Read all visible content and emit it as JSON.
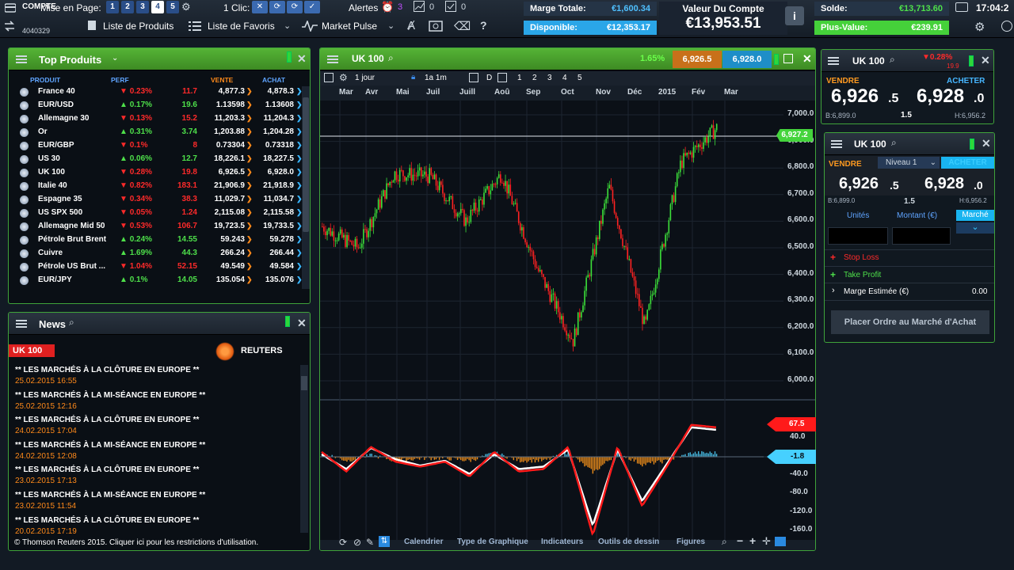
{
  "account": {
    "label": "COMPTE",
    "number": "4040329"
  },
  "pagination": {
    "label": "Mise en Page:",
    "pages": [
      "1",
      "2",
      "3",
      "4",
      "5"
    ]
  },
  "one_click": {
    "label": "1 Clic:"
  },
  "alerts": {
    "label": "Alertes",
    "count_alerts": "3",
    "count_b": "0",
    "count_c": "0"
  },
  "nav": {
    "products": "Liste de Produits",
    "favorites": "Liste de Favoris",
    "pulse": "Market Pulse"
  },
  "stats": {
    "margin_label": "Marge Totale:",
    "margin_value": "€1,600.34",
    "available_label": "Disponible:",
    "available_value": "€12,353.17",
    "account_value_label": "Valeur Du Compte",
    "account_value": "€13,953.51",
    "balance_label": "Solde:",
    "balance_value": "€13,713.60",
    "gain_label": "Plus-Value:",
    "gain_value": "€239.91"
  },
  "clock": "17:04:2",
  "top_products": {
    "title": "Top Produits",
    "headers": {
      "product": "PRODUIT",
      "perf": "PERF",
      "sell": "VENTE",
      "buy": "ACHAT"
    },
    "rows": [
      {
        "name": "France 40",
        "perf": "0.23%",
        "dir": "dn",
        "abs": "11.7",
        "sell": "4,877.3",
        "buy": "4,878.3"
      },
      {
        "name": "EUR/USD",
        "perf": "0.17%",
        "dir": "up",
        "abs": "19.6",
        "sell": "1.13598",
        "buy": "1.13608"
      },
      {
        "name": "Allemagne 30",
        "perf": "0.13%",
        "dir": "dn",
        "abs": "15.2",
        "sell": "11,203.3",
        "buy": "11,204.3"
      },
      {
        "name": "Or",
        "perf": "0.31%",
        "dir": "up",
        "abs": "3.74",
        "sell": "1,203.88",
        "buy": "1,204.28"
      },
      {
        "name": "EUR/GBP",
        "perf": "0.1%",
        "dir": "dn",
        "abs": "8",
        "sell": "0.73304",
        "buy": "0.73318"
      },
      {
        "name": "US 30",
        "perf": "0.06%",
        "dir": "up",
        "abs": "12.7",
        "sell": "18,226.1",
        "buy": "18,227.5"
      },
      {
        "name": "UK 100",
        "perf": "0.28%",
        "dir": "dn",
        "abs": "19.8",
        "sell": "6,926.5",
        "buy": "6,928.0"
      },
      {
        "name": "Italie 40",
        "perf": "0.82%",
        "dir": "dn",
        "abs": "183.1",
        "sell": "21,906.9",
        "buy": "21,918.9"
      },
      {
        "name": "Espagne 35",
        "perf": "0.34%",
        "dir": "dn",
        "abs": "38.3",
        "sell": "11,029.7",
        "buy": "11,034.7"
      },
      {
        "name": "US SPX 500",
        "perf": "0.05%",
        "dir": "dn",
        "abs": "1.24",
        "sell": "2,115.08",
        "buy": "2,115.58"
      },
      {
        "name": "Allemagne Mid 50",
        "perf": "0.53%",
        "dir": "dn",
        "abs": "106.7",
        "sell": "19,723.5",
        "buy": "19,733.5"
      },
      {
        "name": "Pétrole Brut Brent",
        "perf": "0.24%",
        "dir": "up",
        "abs": "14.55",
        "sell": "59.243",
        "buy": "59.278"
      },
      {
        "name": "Cuivre",
        "perf": "1.69%",
        "dir": "up",
        "abs": "44.3",
        "sell": "266.24",
        "buy": "266.44"
      },
      {
        "name": "Pétrole US Brut ...",
        "perf": "1.04%",
        "dir": "dn",
        "abs": "52.15",
        "sell": "49.549",
        "buy": "49.584"
      },
      {
        "name": "EUR/JPY",
        "perf": "0.1%",
        "dir": "up",
        "abs": "14.05",
        "sell": "135.054",
        "buy": "135.076"
      }
    ]
  },
  "news": {
    "title": "News",
    "tag": "UK 100",
    "source": "REUTERS",
    "items": [
      {
        "title": "** LES MARCHÉS À LA CLÔTURE EN EUROPE **",
        "date": "25.02.2015 16:55"
      },
      {
        "title": "** LES MARCHÉS À LA MI-SÉANCE EN EUROPE **",
        "date": "25.02.2015 12:16"
      },
      {
        "title": "** LES MARCHÉS À LA CLÔTURE EN EUROPE **",
        "date": "24.02.2015 17:04"
      },
      {
        "title": "** LES MARCHÉS À LA MI-SÉANCE EN EUROPE **",
        "date": "24.02.2015 12:08"
      },
      {
        "title": "** LES MARCHÉS À LA CLÔTURE EN EUROPE **",
        "date": "23.02.2015 17:13"
      },
      {
        "title": "** LES MARCHÉS À LA MI-SÉANCE EN EUROPE **",
        "date": "23.02.2015 11:54"
      },
      {
        "title": "** LES MARCHÉS À LA CLÔTURE EN EUROPE **",
        "date": "20.02.2015 17:19"
      }
    ],
    "footer": "© Thomson Reuters 2015. Cliquer ici pour les restrictions d'utilisation."
  },
  "chart": {
    "title": "UK 100",
    "change": "1.65%",
    "sell": "6,926.5",
    "buy": "6,928.0",
    "interval": "1 jour",
    "range": "1a 1m",
    "periods": [
      "D",
      "1",
      "2",
      "3",
      "4",
      "5"
    ],
    "last_tag": "6,927.2",
    "macd_tag1": "67.5",
    "macd_tag2": "-1.8",
    "bottom_tabs": [
      "Calendrier",
      "Type de Graphique",
      "Indicateurs",
      "Outils de dessin",
      "Figures"
    ]
  },
  "chart_data": {
    "type": "candlestick",
    "x_labels": [
      "Mar",
      "Avr",
      "Mai",
      "Juil",
      "Juill",
      "Aoû",
      "Sep",
      "Oct",
      "Nov",
      "Déc",
      "2015",
      "Fév",
      "Mar"
    ],
    "y_ticks": [
      "7,000.0",
      "6,900.0",
      "6,800.0",
      "6,700.0",
      "6,600.0",
      "6,500.0",
      "6,400.0",
      "6,300.0",
      "6,200.0",
      "6,100.0",
      "6,000.0"
    ],
    "ylim": [
      6000,
      7000
    ],
    "macd_ticks": [
      "40.0",
      "-40.0",
      "-80.0",
      "-120.0",
      "-160.0"
    ],
    "trend_y": [
      6580,
      6500,
      6780,
      6770,
      6600,
      6780,
      6420,
      6150,
      6730,
      6200,
      6820,
      6950
    ],
    "macd_fast": [
      10,
      -30,
      20,
      -10,
      -20,
      -10,
      -40,
      10,
      -30,
      -25,
      20,
      -160,
      20,
      -100,
      -20,
      65,
      60
    ],
    "macd_signal": [
      5,
      -25,
      18,
      -5,
      -18,
      -8,
      -35,
      5,
      -25,
      -20,
      15,
      -140,
      15,
      -90,
      -15,
      60,
      55
    ],
    "colors": {
      "up": "#3ce03a",
      "down": "#ff2222",
      "macd_fast": "#ff1a1a",
      "macd_signal": "#ffffff",
      "hist_pos": "#46b8e0",
      "hist_neg": "#e88a1a"
    }
  },
  "trade1": {
    "title": "UK 100",
    "change": "▼0.28%",
    "change_abs": "19.9",
    "sell_label": "VENDRE",
    "buy_label": "ACHETER",
    "sell_main": "6,926",
    "sell_dec": ".5",
    "buy_main": "6,928",
    "buy_dec": ".0",
    "low": "B:6,899.0",
    "spread": "1.5",
    "high": "H:6,956.2"
  },
  "trade2": {
    "title": "UK 100",
    "sell_label": "VENDRE",
    "level": "Niveau 1",
    "buy_label": "ACHETER",
    "sell_main": "6,926",
    "sell_dec": ".5",
    "buy_main": "6,928",
    "buy_dec": ".0",
    "low": "B:6,899.0",
    "spread": "1.5",
    "high": "H:6,956.2",
    "units_label": "Unités",
    "amount_label": "Montant (€)",
    "market_label": "Marché",
    "stop_loss": "Stop Loss",
    "take_profit": "Take Profit",
    "margin_label": "Marge Estimée (€)",
    "margin_value": "0.00",
    "place_order": "Placer Ordre au Marché d'Achat"
  }
}
